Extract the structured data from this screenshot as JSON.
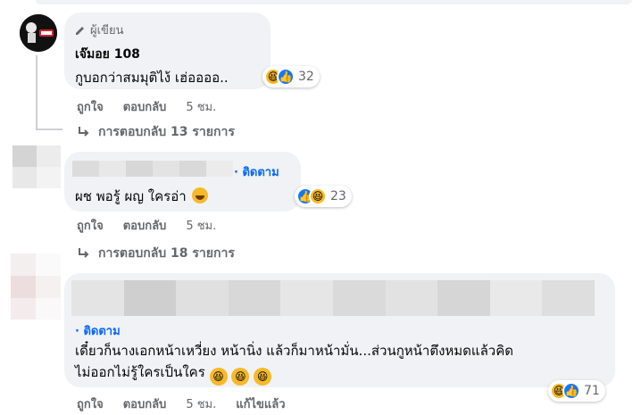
{
  "comments": [
    {
      "author_badge": "ผู้เขียน",
      "name": "เจ๊มอย 108",
      "text": "กูบอกว่าสมมุติไง้ เฮ่ออออ..",
      "reaction_count": "32",
      "actions": {
        "like": "ถูกใจ",
        "reply": "ตอบกลับ",
        "time": "5 ชม."
      },
      "replies": "การตอบกลับ 13 รายการ"
    },
    {
      "follow": "· ติดตาม",
      "text": "ผช พอรู้ ผญ ใครอ่า",
      "reaction_count": "23",
      "actions": {
        "like": "ถูกใจ",
        "reply": "ตอบกลับ",
        "time": "5 ชม."
      },
      "replies": "การตอบกลับ 18 รายการ"
    },
    {
      "follow": "· ติดตาม",
      "text_line1": "เดี๋ยวก็นางเอกหน้าเหวี่ยง หน้านิ่ง แล้วก็มาหน้ามั่น...ส่วนกูหน้าตึงหมดแล้วคิด",
      "text_line2": "ไม่ออกไม่รู้ใครเป็นใคร",
      "reaction_count": "71",
      "actions": {
        "like": "ถูกใจ",
        "reply": "ตอบกลับ",
        "time": "5 ชม.",
        "edited": "แก้ไขแล้ว"
      }
    }
  ],
  "icons": {
    "pencil": "pencil-icon",
    "reply_arrow": "reply-arrow-icon",
    "like": "like-reaction-icon",
    "haha": "haha-reaction-icon"
  },
  "colors": {
    "bubble": "#f0f2f5",
    "link": "#0866ff",
    "meta": "#65676b",
    "like": "#1877f2",
    "haha": "#f7b928"
  }
}
